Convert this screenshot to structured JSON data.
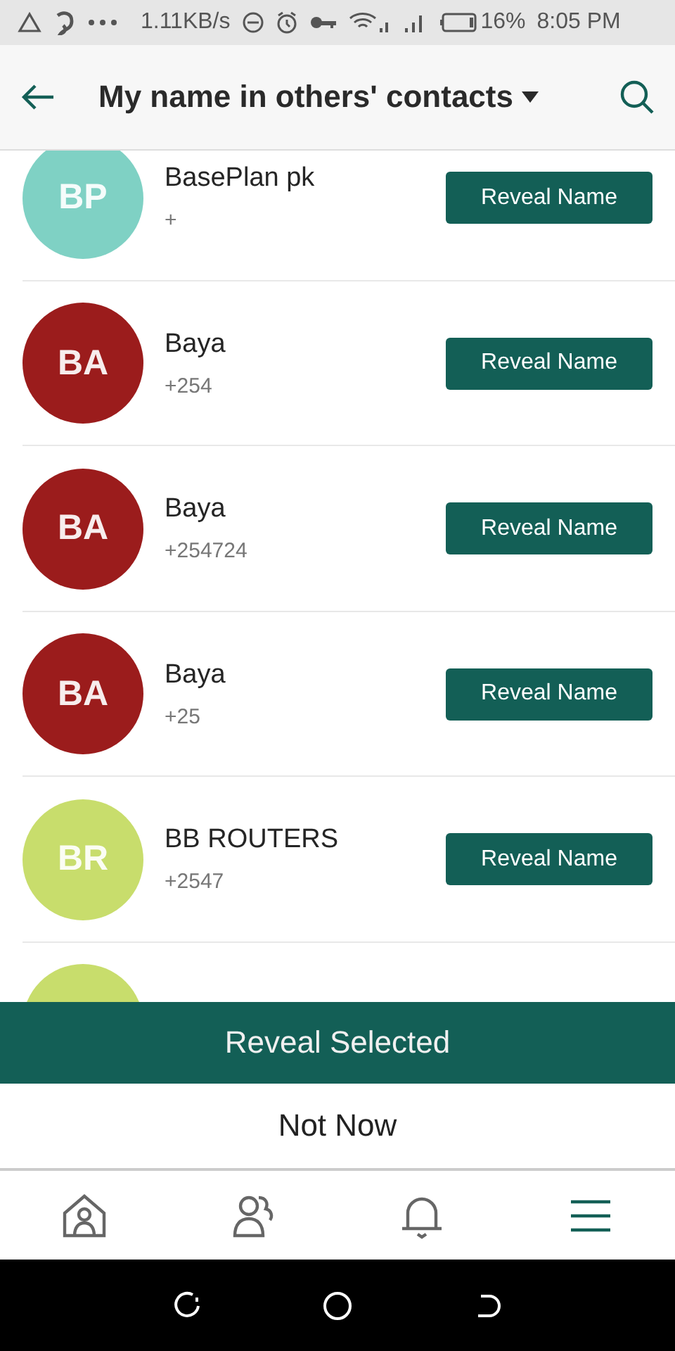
{
  "status_bar": {
    "speed": "1.11KB/s",
    "battery": "16%",
    "time": "8:05 PM"
  },
  "header": {
    "title": "My name in others' contacts"
  },
  "contacts": [
    {
      "initials": "BP",
      "name": "BasePlan pk",
      "phone": "+",
      "color": "#7fd1c4",
      "action": "Reveal Name"
    },
    {
      "initials": "BA",
      "name": "Baya",
      "phone": "+254",
      "color": "#9b1c1c",
      "action": "Reveal Name"
    },
    {
      "initials": "BA",
      "name": "Baya",
      "phone": "+254724",
      "color": "#9b1c1c",
      "action": "Reveal Name"
    },
    {
      "initials": "BA",
      "name": "Baya",
      "phone": "+25",
      "color": "#9b1c1c",
      "action": "Reveal Name"
    },
    {
      "initials": "BR",
      "name": "BB ROUTERS",
      "phone": "+2547",
      "color": "#c8dd6c",
      "action": "Reveal Name"
    }
  ],
  "peek_row": {
    "color": "#c8dd6c"
  },
  "primary_button": "Reveal Selected",
  "secondary_button": "Not Now",
  "bottom_nav": [
    {
      "kind": "home",
      "selected": false
    },
    {
      "kind": "people",
      "selected": false
    },
    {
      "kind": "bell",
      "selected": false
    },
    {
      "kind": "menu",
      "selected": true
    }
  ]
}
